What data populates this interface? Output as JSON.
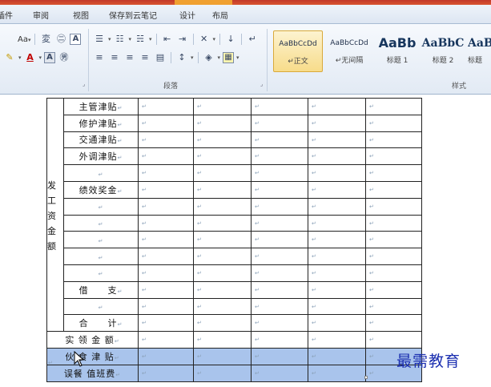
{
  "tabs": [
    "插件",
    "审阅",
    "视图",
    "保存到云笔记",
    "设计",
    "布局"
  ],
  "ribbon": {
    "font_size_label": "Aa",
    "paragraph_group_label": "段落",
    "styles_group_label": "样式",
    "styles": [
      {
        "preview": "AaBbCcDd",
        "name": "↵正文"
      },
      {
        "preview": "AaBbCcDd",
        "name": "↵无间隔"
      },
      {
        "preview": "AaBb",
        "name": "标题 1"
      },
      {
        "preview": "AaBbC",
        "name": "标题 2"
      },
      {
        "preview": "AaB",
        "name": "标题"
      }
    ]
  },
  "document": {
    "vertical_label": [
      "发",
      "工",
      "资",
      "金",
      "额"
    ],
    "rows": [
      "主管津贴",
      "修护津贴",
      "交通津贴",
      "外调津贴",
      "",
      "绩效奖金",
      "",
      "",
      "",
      "",
      "",
      "借　　支",
      "",
      "合　　计"
    ],
    "total_row": "实 领 金 额",
    "highlight_rows": [
      "伙 食 津 贴",
      "误餐 值班费"
    ],
    "paragraph_mark": "↵"
  },
  "watermark": "最需教育",
  "colors": {
    "highlight": "#a9c4ec",
    "watermark": "#1b2fb0",
    "title_bar": "#c23a2a"
  }
}
